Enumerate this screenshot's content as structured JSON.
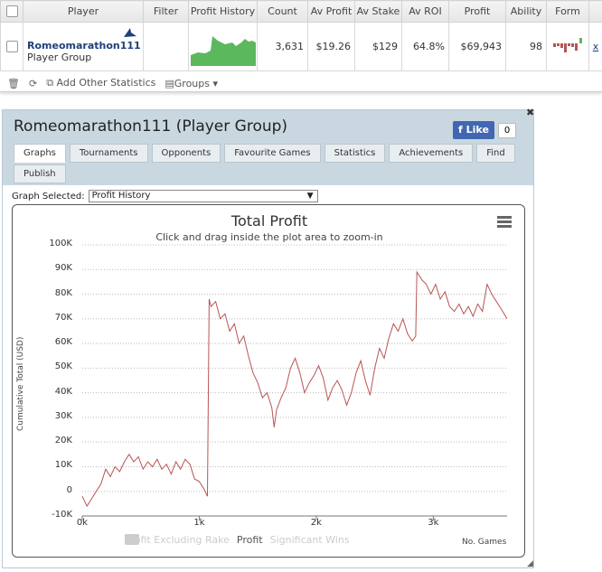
{
  "stats_table": {
    "headers": [
      "Player",
      "Filter",
      "Profit History",
      "Count",
      "Av Profit",
      "Av Stake",
      "Av ROI",
      "Profit",
      "Ability",
      "Form"
    ],
    "row": {
      "name": "Romeomarathon111",
      "group": "Player Group",
      "count": "3,631",
      "av_profit": "$19.26",
      "av_stake": "$129",
      "av_roi": "64.8%",
      "profit": "$69,943",
      "ability": "98",
      "remove": "x"
    },
    "toolbar": {
      "add_stats": "Add Other Statistics",
      "groups": "Groups"
    }
  },
  "panel": {
    "title": "Romeomarathon111 (Player Group)",
    "like_label": "Like",
    "like_count": "0",
    "tabs": [
      "Graphs",
      "Tournaments",
      "Opponents",
      "Favourite Games",
      "Statistics",
      "Achievements",
      "Find",
      "Publish"
    ],
    "graph_selected_label": "Graph Selected:",
    "graph_selected_value": "Profit History"
  },
  "chart_data": {
    "type": "line",
    "title": "Total Profit",
    "subtitle": "Click and drag inside the plot area to zoom-in",
    "ylabel": "Cumulative Total (USD)",
    "xlabel": "No. Games",
    "xlim": [
      0,
      3631
    ],
    "ylim": [
      -10000,
      100000
    ],
    "y_ticks": [
      "100K",
      "90K",
      "80K",
      "70K",
      "60K",
      "50K",
      "40K",
      "30K",
      "20K",
      "10K",
      "0",
      "-10K"
    ],
    "x_ticks": [
      "0k",
      "1k",
      "2k",
      "3k"
    ],
    "grid": true,
    "legend_position": "bottom",
    "legend": [
      "Profit Excluding Rake",
      "Profit",
      "Significant Wins"
    ],
    "series": [
      {
        "name": "Profit",
        "color": "#b85454",
        "x": [
          0,
          40,
          80,
          120,
          160,
          200,
          240,
          280,
          320,
          360,
          400,
          440,
          480,
          520,
          560,
          600,
          640,
          680,
          720,
          760,
          800,
          840,
          880,
          920,
          960,
          1000,
          1040,
          1070,
          1085,
          1100,
          1140,
          1180,
          1220,
          1260,
          1300,
          1340,
          1380,
          1420,
          1460,
          1500,
          1540,
          1580,
          1620,
          1640,
          1660,
          1700,
          1740,
          1780,
          1820,
          1860,
          1900,
          1940,
          1980,
          2020,
          2060,
          2100,
          2140,
          2180,
          2220,
          2260,
          2300,
          2340,
          2380,
          2420,
          2460,
          2500,
          2540,
          2580,
          2620,
          2660,
          2700,
          2740,
          2780,
          2820,
          2850,
          2860,
          2900,
          2940,
          2980,
          3020,
          3060,
          3100,
          3140,
          3180,
          3220,
          3260,
          3300,
          3340,
          3380,
          3420,
          3460,
          3500,
          3540,
          3580,
          3631
        ],
        "values": [
          -2000,
          -6000,
          -3000,
          0,
          3000,
          9000,
          6000,
          10000,
          8000,
          12000,
          15000,
          12000,
          14000,
          9000,
          12000,
          10000,
          13000,
          9000,
          11000,
          7000,
          12000,
          9000,
          13000,
          11000,
          5000,
          4000,
          1000,
          -2000,
          78000,
          75000,
          77000,
          70000,
          72000,
          65000,
          68000,
          60000,
          63000,
          55000,
          48000,
          44000,
          38000,
          40000,
          34000,
          26000,
          33000,
          38000,
          42000,
          50000,
          54000,
          48000,
          40000,
          44000,
          47000,
          51000,
          46000,
          37000,
          42000,
          45000,
          41000,
          35000,
          40000,
          48000,
          53000,
          45000,
          39000,
          50000,
          58000,
          54000,
          62000,
          68000,
          65000,
          70000,
          64000,
          61000,
          63000,
          89000,
          86000,
          84000,
          80000,
          84000,
          78000,
          81000,
          75000,
          73000,
          76000,
          72000,
          75000,
          71000,
          76000,
          73000,
          84000,
          80000,
          77000,
          74000,
          70000
        ]
      }
    ]
  }
}
